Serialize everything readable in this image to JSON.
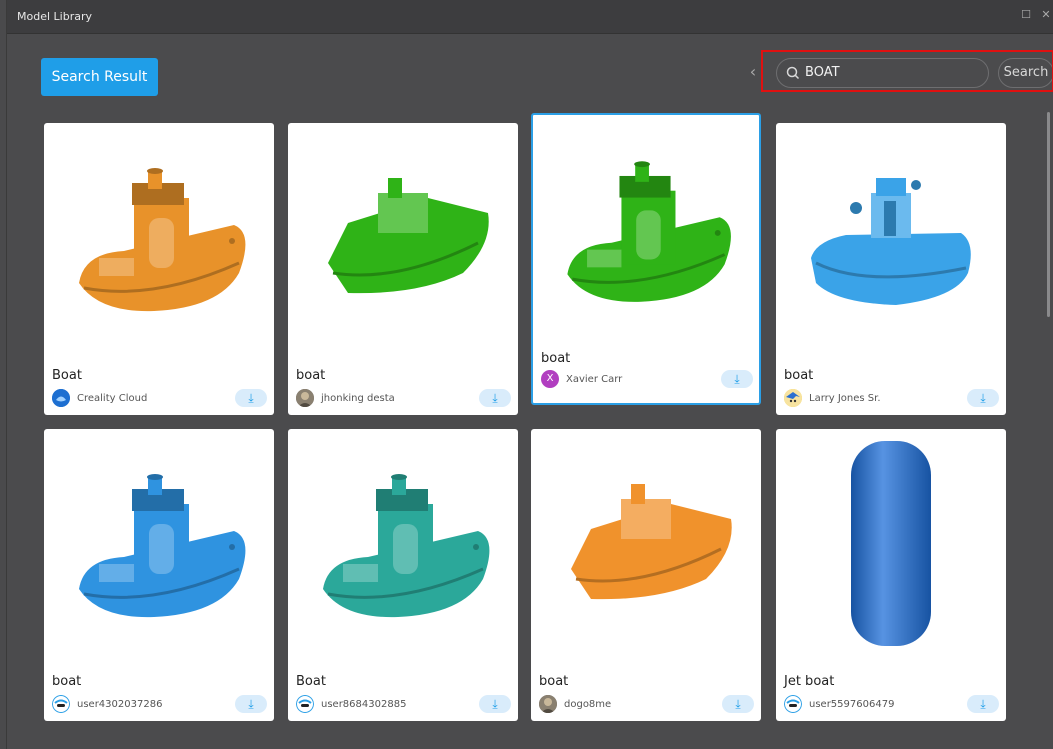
{
  "window": {
    "title": "Model Library"
  },
  "toolbar": {
    "search_result_label": "Search Result",
    "search_value": "BOAT",
    "search_button_label": "Search"
  },
  "colors": {
    "accent": "#1f9ee8",
    "highlight": "#e01010"
  },
  "models": [
    {
      "name": "Boat",
      "author": "Creality Cloud",
      "model_color": "#e8922a",
      "avatar_icon": "creality-logo-icon"
    },
    {
      "name": "boat",
      "author": "jhonking desta",
      "model_color": "#2fb317",
      "avatar_icon": "user-photo-icon"
    },
    {
      "name": "boat",
      "author": "Xavier Carr",
      "model_color": "#2fb317",
      "avatar_letter": "X",
      "avatar_icon": "letter-avatar-icon"
    },
    {
      "name": "boat",
      "author": "Larry Jones Sr.",
      "model_color": "#3aa3e8",
      "avatar_icon": "cartoon-avatar-icon"
    },
    {
      "name": "boat",
      "author": "user4302037286",
      "model_color": "#2f93e0",
      "avatar_icon": "default-avatar-icon"
    },
    {
      "name": "Boat",
      "author": "user8684302885",
      "model_color": "#2ba89a",
      "avatar_icon": "default-avatar-icon"
    },
    {
      "name": "boat",
      "author": "dogo8me",
      "model_color": "#f0922c",
      "avatar_icon": "user-photo-icon"
    },
    {
      "name": "Jet boat",
      "author": "user5597606479",
      "model_color": "#1f6fd8",
      "avatar_icon": "default-avatar-icon"
    }
  ]
}
